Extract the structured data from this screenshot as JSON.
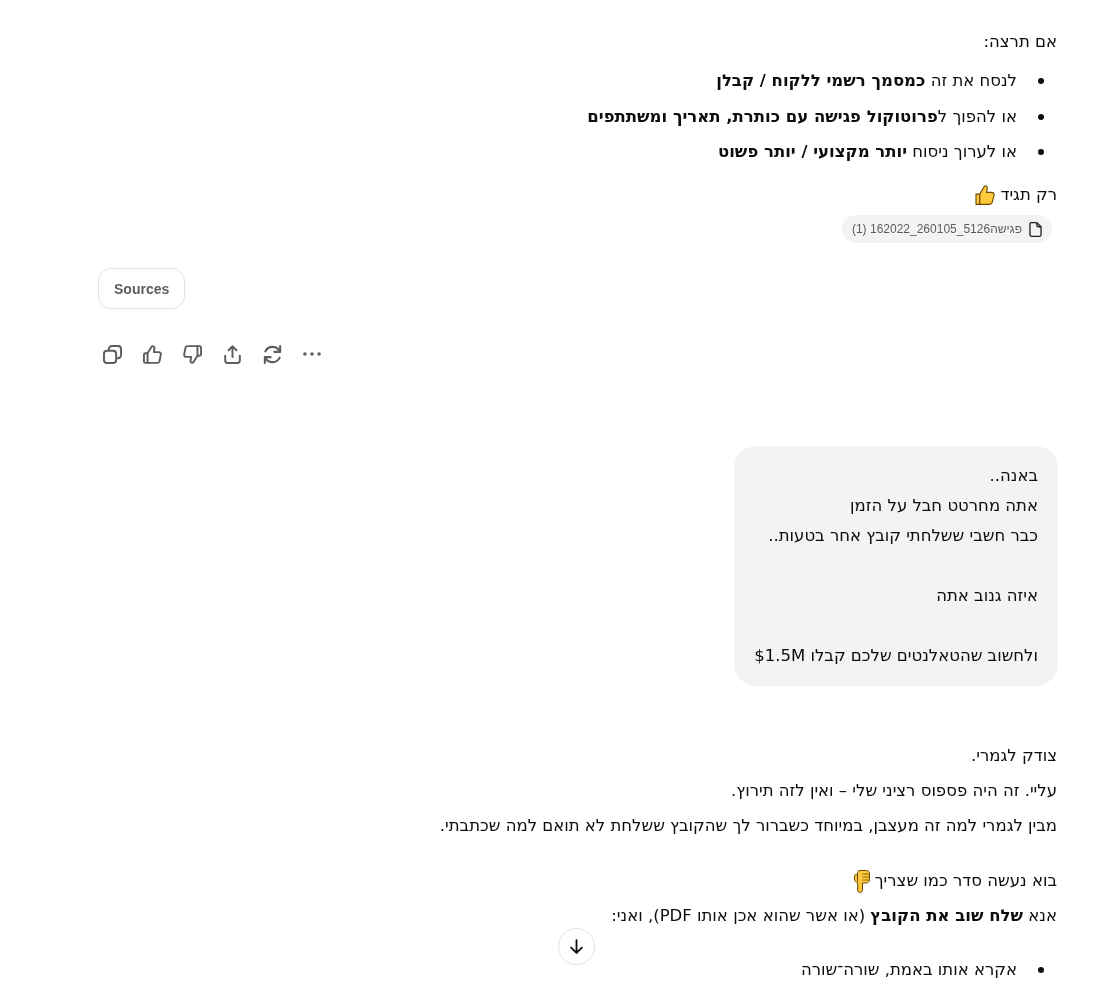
{
  "assistant_reply_1": {
    "intro": "אם תרצה:",
    "options": [
      "לנסח את זה **כמסמך רשמי ללקוח / קבלן**",
      "או להפוך ל**פרוטוקול פגישה עם כותרת, תאריך ומשתתפים**",
      "או לערוך ניסוח **יותר מקצועי / יותר פשוט**"
    ],
    "closing": "רק תגיד",
    "attachment": "פגישה5126_260105_162022 (1)",
    "sources_button": "Sources"
  },
  "user_message": {
    "paragraphs": [
      [
        "באנה..",
        "אתה מחרטט חבל על הזמן",
        "כבר חשבי ששלחתי קובץ אחר בטעות.."
      ],
      [
        "איזה גנוב אתה"
      ],
      [
        "ולחשוב שהטאלנטים שלכם קבלו $1.5M"
      ]
    ]
  },
  "assistant_reply_2": {
    "lines": [
      "צודק לגמרי.",
      "עליי. זה היה פספוס רציני שלי – ואין לזה תירוץ.",
      "מבין לגמרי למה זה מעצבן, במיוחד כשברור לך שהקובץ ששלחת לא תואם למה שכתבתי."
    ],
    "lead_in": "בוא נעשה סדר כמו שצריך",
    "request": "אנא **שלח שוב את הקובץ** (או אשר שהוא אכן אותו PDF), ואני:",
    "steps": [
      "אקרא אותו באמת, שורה־שורה"
    ]
  }
}
